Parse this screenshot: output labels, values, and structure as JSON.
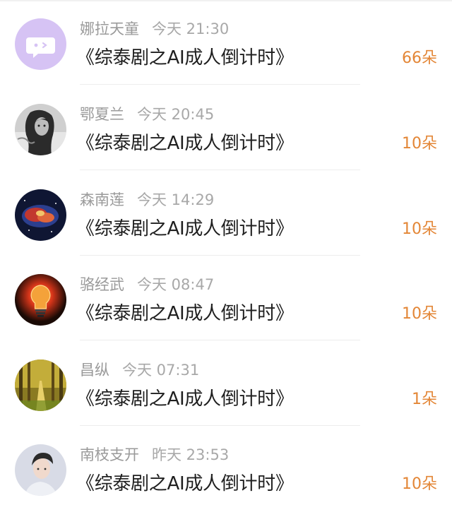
{
  "items": [
    {
      "name": "娜拉天童",
      "time": "今天 21:30",
      "title": "《综泰剧之AI成人倒计时》",
      "count": "66朵",
      "avatar_icon": "chat-bubble-face-icon",
      "avatar_color": "#d6c3f4"
    },
    {
      "name": "鄂夏兰",
      "time": "今天 20:45",
      "title": "《综泰剧之AI成人倒计时》",
      "count": "10朵",
      "avatar_icon": "girl-photo-icon",
      "avatar_color": "#5c5c5c"
    },
    {
      "name": "森南莲",
      "time": "今天 14:29",
      "title": "《综泰剧之AI成人倒计时》",
      "count": "10朵",
      "avatar_icon": "nebula-photo-icon",
      "avatar_color": "#0f1633"
    },
    {
      "name": "骆经武",
      "time": "今天 08:47",
      "title": "《综泰剧之AI成人倒计时》",
      "count": "10朵",
      "avatar_icon": "lightbulb-photo-icon",
      "avatar_color": "#1a0a05"
    },
    {
      "name": "昌纵",
      "time": "今天 07:31",
      "title": "《综泰剧之AI成人倒计时》",
      "count": "1朵",
      "avatar_icon": "forest-path-photo-icon",
      "avatar_color": "#8a7a22"
    },
    {
      "name": "南枝支开",
      "time": "昨天 23:53",
      "title": "《综泰剧之AI成人倒计时》",
      "count": "10朵",
      "avatar_icon": "man-portrait-photo-icon",
      "avatar_color": "#d8dbe6"
    }
  ],
  "colors": {
    "count_accent": "#e38636",
    "meta_gray": "#9a9a9a",
    "title_text": "#1f1f1f"
  }
}
